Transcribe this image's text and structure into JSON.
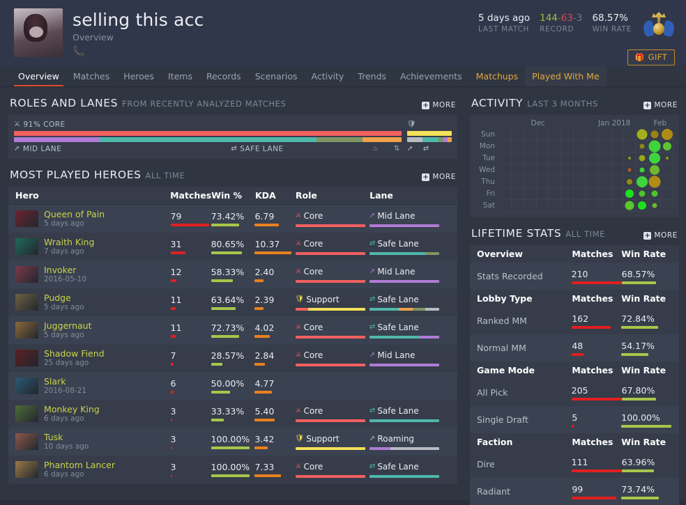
{
  "header": {
    "player_name": "selling this acc",
    "subtitle": "Overview",
    "phone_icon": "phone-icon",
    "avatar_name": "player-avatar",
    "medal_name": "rank-medal-icon",
    "last_match": {
      "value": "5 days ago",
      "label": "LAST MATCH"
    },
    "record": {
      "wins": "144",
      "sep1": "-",
      "losses": "63",
      "sep2": "-",
      "draws": "3",
      "label": "RECORD"
    },
    "win_rate": {
      "value": "68.57%",
      "label": "WIN RATE"
    },
    "gift_button": {
      "icon": "gift-icon",
      "label": "GIFT"
    }
  },
  "tabs": [
    {
      "label": "Overview",
      "state": "active"
    },
    {
      "label": "Matches",
      "state": "normal"
    },
    {
      "label": "Heroes",
      "state": "normal"
    },
    {
      "label": "Items",
      "state": "normal"
    },
    {
      "label": "Records",
      "state": "normal"
    },
    {
      "label": "Scenarios",
      "state": "normal"
    },
    {
      "label": "Activity",
      "state": "normal"
    },
    {
      "label": "Trends",
      "state": "normal"
    },
    {
      "label": "Achievements",
      "state": "normal"
    },
    {
      "label": "Matchups",
      "state": "gold"
    },
    {
      "label": "Played With Me",
      "state": "gold-shade"
    }
  ],
  "roles_and_lanes": {
    "title": "ROLES AND LANES",
    "subtitle": "FROM RECENTLY ANALYZED MATCHES",
    "more_label": "MORE",
    "core_label": "91% CORE",
    "core_icon": "core-icon",
    "support_icon": "support-icon",
    "mid_lane_label": "MID LANE",
    "mid_lane_icon": "mid-lane-icon",
    "safe_lane_label": "SAFE LANE",
    "safe_lane_icon": "safe-lane-icon",
    "offlane_icon": "offlane-icon",
    "jungle_icon": "jungle-icon",
    "roaming_icon": "roaming-icon",
    "side_safe_icon": "safe-lane-icon",
    "main_role_bar": [
      {
        "color": "#f2605f",
        "pct": 100
      }
    ],
    "main_lane_bar": [
      {
        "color": "#b07cd6",
        "pct": 22
      },
      {
        "color": "#4fb8ab",
        "pct": 56
      },
      {
        "color": "#7f9663",
        "pct": 12
      },
      {
        "color": "#f0a04b",
        "pct": 10
      }
    ],
    "side_role_bar": [
      {
        "color": "#f2e05a",
        "pct": 100
      }
    ],
    "side_lane_bar": [
      {
        "color": "#b9bcc2",
        "pct": 34
      },
      {
        "color": "#4fb8ab",
        "pct": 36
      },
      {
        "color": "#7f9663",
        "pct": 12
      },
      {
        "color": "#b07cd6",
        "pct": 9
      },
      {
        "color": "#f0a04b",
        "pct": 9
      }
    ]
  },
  "most_played": {
    "title": "MOST PLAYED HEROES",
    "subtitle": "ALL TIME",
    "more_label": "MORE",
    "columns": [
      "Hero",
      "Matches",
      "Win %",
      "KDA",
      "Role",
      "Lane"
    ],
    "rows": [
      {
        "hero": "Queen of Pain",
        "date": "5 days ago",
        "portrait": "#6b2430",
        "matches": "79",
        "matches_pct": 100,
        "winpct": "73.42%",
        "win_pct_bar": 73,
        "kda": "6.79",
        "kda_pct": 62,
        "role": "Core",
        "role_icon": "core-icon",
        "role_bar": [
          {
            "color": "#f2605f",
            "pct": 100
          }
        ],
        "lane": "Mid Lane",
        "lane_icon": "mid-lane-icon",
        "lane_bar": [
          {
            "color": "#b07cd6",
            "pct": 100
          }
        ]
      },
      {
        "hero": "Wraith King",
        "date": "7 days ago",
        "portrait": "#1f6b5a",
        "matches": "31",
        "matches_pct": 39,
        "winpct": "80.65%",
        "win_pct_bar": 81,
        "kda": "10.37",
        "kda_pct": 95,
        "role": "Core",
        "role_icon": "core-icon",
        "role_bar": [
          {
            "color": "#f2605f",
            "pct": 100
          }
        ],
        "lane": "Safe Lane",
        "lane_icon": "safe-lane-icon",
        "lane_bar": [
          {
            "color": "#4fb8ab",
            "pct": 80
          },
          {
            "color": "#7f9663",
            "pct": 20
          }
        ]
      },
      {
        "hero": "Invoker",
        "date": "2016-05-10",
        "portrait": "#7a3b4a",
        "matches": "12",
        "matches_pct": 15,
        "winpct": "58.33%",
        "win_pct_bar": 58,
        "kda": "2.40",
        "kda_pct": 23,
        "role": "Core",
        "role_icon": "core-icon",
        "role_bar": [
          {
            "color": "#f2605f",
            "pct": 100
          }
        ],
        "lane": "Mid Lane",
        "lane_icon": "mid-lane-icon",
        "lane_bar": [
          {
            "color": "#b07cd6",
            "pct": 100
          }
        ]
      },
      {
        "hero": "Pudge",
        "date": "5 days ago",
        "portrait": "#6d6144",
        "matches": "11",
        "matches_pct": 14,
        "winpct": "63.64%",
        "win_pct_bar": 64,
        "kda": "2.39",
        "kda_pct": 22,
        "role": "Support",
        "role_icon": "support-icon",
        "role_bar": [
          {
            "color": "#f2605f",
            "pct": 18
          },
          {
            "color": "#f2e05a",
            "pct": 82
          }
        ],
        "lane": "Safe Lane",
        "lane_icon": "safe-lane-icon",
        "lane_bar": [
          {
            "color": "#4fb8ab",
            "pct": 42
          },
          {
            "color": "#f0a04b",
            "pct": 20
          },
          {
            "color": "#7f9663",
            "pct": 18
          },
          {
            "color": "#b9bcc2",
            "pct": 20
          }
        ]
      },
      {
        "hero": "Juggernaut",
        "date": "5 days ago",
        "portrait": "#8a6a3a",
        "matches": "11",
        "matches_pct": 14,
        "winpct": "72.73%",
        "win_pct_bar": 73,
        "kda": "4.02",
        "kda_pct": 39,
        "role": "Core",
        "role_icon": "core-icon",
        "role_bar": [
          {
            "color": "#f2605f",
            "pct": 100
          }
        ],
        "lane": "Safe Lane",
        "lane_icon": "safe-lane-icon",
        "lane_bar": [
          {
            "color": "#4fb8ab",
            "pct": 72
          },
          {
            "color": "#b07cd6",
            "pct": 28
          }
        ]
      },
      {
        "hero": "Shadow Fiend",
        "date": "25 days ago",
        "portrait": "#5c1f22",
        "matches": "7",
        "matches_pct": 9,
        "winpct": "28.57%",
        "win_pct_bar": 29,
        "kda": "2.84",
        "kda_pct": 27,
        "role": "Core",
        "role_icon": "core-icon",
        "role_bar": [
          {
            "color": "#f2605f",
            "pct": 100
          }
        ],
        "lane": "Mid Lane",
        "lane_icon": "mid-lane-icon",
        "lane_bar": [
          {
            "color": "#b07cd6",
            "pct": 100
          }
        ]
      },
      {
        "hero": "Slark",
        "date": "2016-08-21",
        "portrait": "#2b5a72",
        "matches": "6",
        "matches_pct": 8,
        "winpct": "50.00%",
        "win_pct_bar": 50,
        "kda": "4.77",
        "kda_pct": 45,
        "role": "",
        "role_icon": "",
        "role_bar": [],
        "lane": "",
        "lane_icon": "",
        "lane_bar": []
      },
      {
        "hero": "Monkey King",
        "date": "6 days ago",
        "portrait": "#4e6b3a",
        "matches": "3",
        "matches_pct": 4,
        "winpct": "33.33%",
        "win_pct_bar": 33,
        "kda": "5.40",
        "kda_pct": 51,
        "role": "Core",
        "role_icon": "core-icon",
        "role_bar": [
          {
            "color": "#f2605f",
            "pct": 100
          }
        ],
        "lane": "Safe Lane",
        "lane_icon": "safe-lane-icon",
        "lane_bar": [
          {
            "color": "#4fb8ab",
            "pct": 100
          }
        ]
      },
      {
        "hero": "Tusk",
        "date": "10 days ago",
        "portrait": "#8a5a4a",
        "matches": "3",
        "matches_pct": 4,
        "winpct": "100.00%",
        "win_pct_bar": 100,
        "kda": "3.42",
        "kda_pct": 33,
        "role": "Support",
        "role_icon": "support-icon",
        "role_bar": [
          {
            "color": "#f2e05a",
            "pct": 100
          }
        ],
        "lane": "Roaming",
        "lane_icon": "roaming-icon",
        "lane_bar": [
          {
            "color": "#b07cd6",
            "pct": 30
          },
          {
            "color": "#b9bcc2",
            "pct": 70
          }
        ]
      },
      {
        "hero": "Phantom Lancer",
        "date": "6 days ago",
        "portrait": "#9a7a46",
        "matches": "3",
        "matches_pct": 4,
        "winpct": "100.00%",
        "win_pct_bar": 100,
        "kda": "7.33",
        "kda_pct": 69,
        "role": "Core",
        "role_icon": "core-icon",
        "role_bar": [
          {
            "color": "#f2605f",
            "pct": 100
          }
        ],
        "lane": "Safe Lane",
        "lane_icon": "safe-lane-icon",
        "lane_bar": [
          {
            "color": "#4fb8ab",
            "pct": 100
          }
        ]
      }
    ]
  },
  "activity": {
    "title": "ACTIVITY",
    "subtitle": "LAST 3 MONTHS",
    "more_label": "MORE",
    "months": [
      "Dec",
      "Jan 2018",
      "Feb"
    ],
    "days": [
      "Sun",
      "Mon",
      "Tue",
      "Wed",
      "Thu",
      "Fri",
      "Sat"
    ],
    "columns": 14,
    "dots": [
      {
        "row": 0,
        "col": 11,
        "size": 15,
        "color": "#a3b01c"
      },
      {
        "row": 0,
        "col": 12,
        "size": 11,
        "color": "#9a8416"
      },
      {
        "row": 0,
        "col": 13,
        "size": 16,
        "color": "#b08c14"
      },
      {
        "row": 1,
        "col": 11,
        "size": 7,
        "color": "#8a8a18"
      },
      {
        "row": 1,
        "col": 12,
        "size": 17,
        "color": "#3ed43e"
      },
      {
        "row": 1,
        "col": 13,
        "size": 12,
        "color": "#5cc62e"
      },
      {
        "row": 2,
        "col": 10,
        "size": 4,
        "color": "#8a9a1c"
      },
      {
        "row": 2,
        "col": 11,
        "size": 9,
        "color": "#97a61c"
      },
      {
        "row": 2,
        "col": 12,
        "size": 16,
        "color": "#3ed43e"
      },
      {
        "row": 2,
        "col": 13,
        "size": 4,
        "color": "#8a9a1c"
      },
      {
        "row": 3,
        "col": 10,
        "size": 5,
        "color": "#b85a1c"
      },
      {
        "row": 3,
        "col": 11,
        "size": 7,
        "color": "#3ed43e"
      },
      {
        "row": 3,
        "col": 12,
        "size": 14,
        "color": "#6db82c"
      },
      {
        "row": 4,
        "col": 10,
        "size": 8,
        "color": "#9a8416"
      },
      {
        "row": 4,
        "col": 11,
        "size": 16,
        "color": "#3ed43e"
      },
      {
        "row": 4,
        "col": 12,
        "size": 17,
        "color": "#b08c14"
      },
      {
        "row": 5,
        "col": 10,
        "size": 12,
        "color": "#1fe01f"
      },
      {
        "row": 5,
        "col": 11,
        "size": 9,
        "color": "#4ec42e"
      },
      {
        "row": 5,
        "col": 12,
        "size": 9,
        "color": "#4ec42e"
      },
      {
        "row": 6,
        "col": 10,
        "size": 13,
        "color": "#5cc62e"
      },
      {
        "row": 6,
        "col": 11,
        "size": 12,
        "color": "#1fe01f"
      },
      {
        "row": 6,
        "col": 12,
        "size": 7,
        "color": "#6db82c"
      }
    ]
  },
  "lifetime": {
    "title": "LIFETIME STATS",
    "subtitle": "ALL TIME",
    "more_label": "MORE",
    "groups": [
      {
        "header": [
          "Overview",
          "Matches",
          "Win Rate"
        ],
        "rows": [
          {
            "label": "Stats Recorded",
            "matches": "210",
            "matches_pct": 100,
            "winrate": "68.57%",
            "win_pct": 69
          }
        ]
      },
      {
        "header": [
          "Lobby Type",
          "Matches",
          "Win Rate"
        ],
        "rows": [
          {
            "label": "Ranked MM",
            "matches": "162",
            "matches_pct": 77,
            "winrate": "72.84%",
            "win_pct": 73
          },
          {
            "label": "Normal MM",
            "matches": "48",
            "matches_pct": 23,
            "winrate": "54.17%",
            "win_pct": 54
          }
        ]
      },
      {
        "header": [
          "Game Mode",
          "Matches",
          "Win Rate"
        ],
        "rows": [
          {
            "label": "All Pick",
            "matches": "205",
            "matches_pct": 100,
            "winrate": "67.80%",
            "win_pct": 68
          },
          {
            "label": "Single Draft",
            "matches": "5",
            "matches_pct": 3,
            "winrate": "100.00%",
            "win_pct": 100
          }
        ]
      },
      {
        "header": [
          "Faction",
          "Matches",
          "Win Rate"
        ],
        "rows": [
          {
            "label": "Dire",
            "matches": "111",
            "matches_pct": 100,
            "winrate": "63.96%",
            "win_pct": 64
          },
          {
            "label": "Radiant",
            "matches": "99",
            "matches_pct": 89,
            "winrate": "73.74%",
            "win_pct": 74
          }
        ]
      }
    ]
  },
  "colors": {
    "accent_red": "#e04a2f",
    "gold": "#e0a93c",
    "hero_name": "#c9d44a",
    "bar_red": "#e02020",
    "bar_green": "#a8c64a",
    "bar_orange": "#e8811f",
    "core_red": "#f2605f",
    "support_yellow": "#f2e05a",
    "mid_purple": "#b07cd6",
    "safe_teal": "#4fb8ab"
  }
}
